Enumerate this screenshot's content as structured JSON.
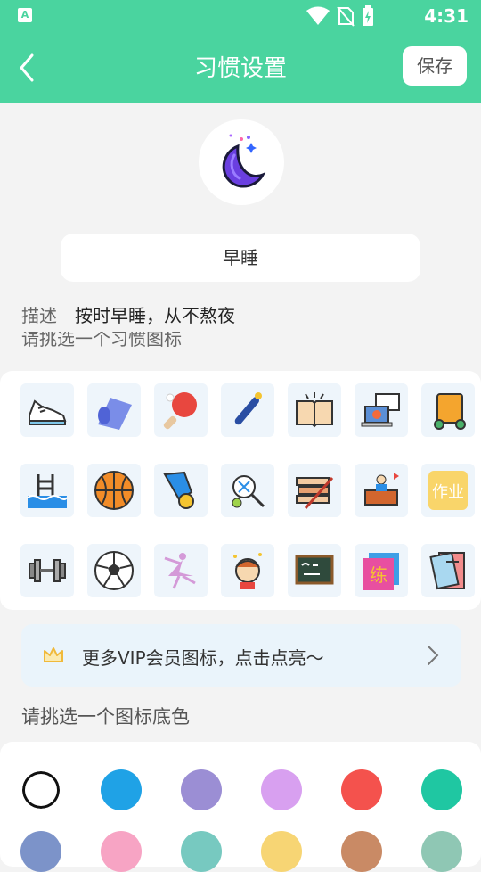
{
  "status": {
    "time": "4:31",
    "app_icon": "A"
  },
  "appbar": {
    "title": "习惯设置",
    "save_label": "保存"
  },
  "habit": {
    "name": "早睡",
    "description_label": "描述",
    "description": "按时早睡，从不熬夜",
    "icon": "moon-icon"
  },
  "icon_section": {
    "label": "请挑选一个习惯图标"
  },
  "icons": [
    "sneaker-icon",
    "yoga-mat-icon",
    "ping-pong-icon",
    "baseball-bat-icon",
    "open-book-icon",
    "online-class-icon",
    "luggage-icon",
    "swimming-pool-icon",
    "basketball-icon",
    "badminton-icon",
    "tennis-icon",
    "study-books-icon",
    "lecture-desk-icon",
    "homework-icon",
    "dumbbell-icon",
    "soccer-ball-icon",
    "ballet-icon",
    "thinking-icon",
    "blackboard-icon",
    "practice-icon",
    "notebook-icon"
  ],
  "homework_text": "作业",
  "practice_text": "练",
  "vip": {
    "text": "更多VIP会员图标，点击点亮～"
  },
  "color_section": {
    "label": "请挑选一个图标底色"
  },
  "colors": [
    "#ffffff",
    "#1fa2e6",
    "#9b8ed4",
    "#d8a0f0",
    "#f4524d",
    "#1fc7a2",
    "#7c93c9",
    "#f7a4c4",
    "#77c9c0",
    "#f7d574",
    "#c98a65",
    "#8fc7b4"
  ]
}
